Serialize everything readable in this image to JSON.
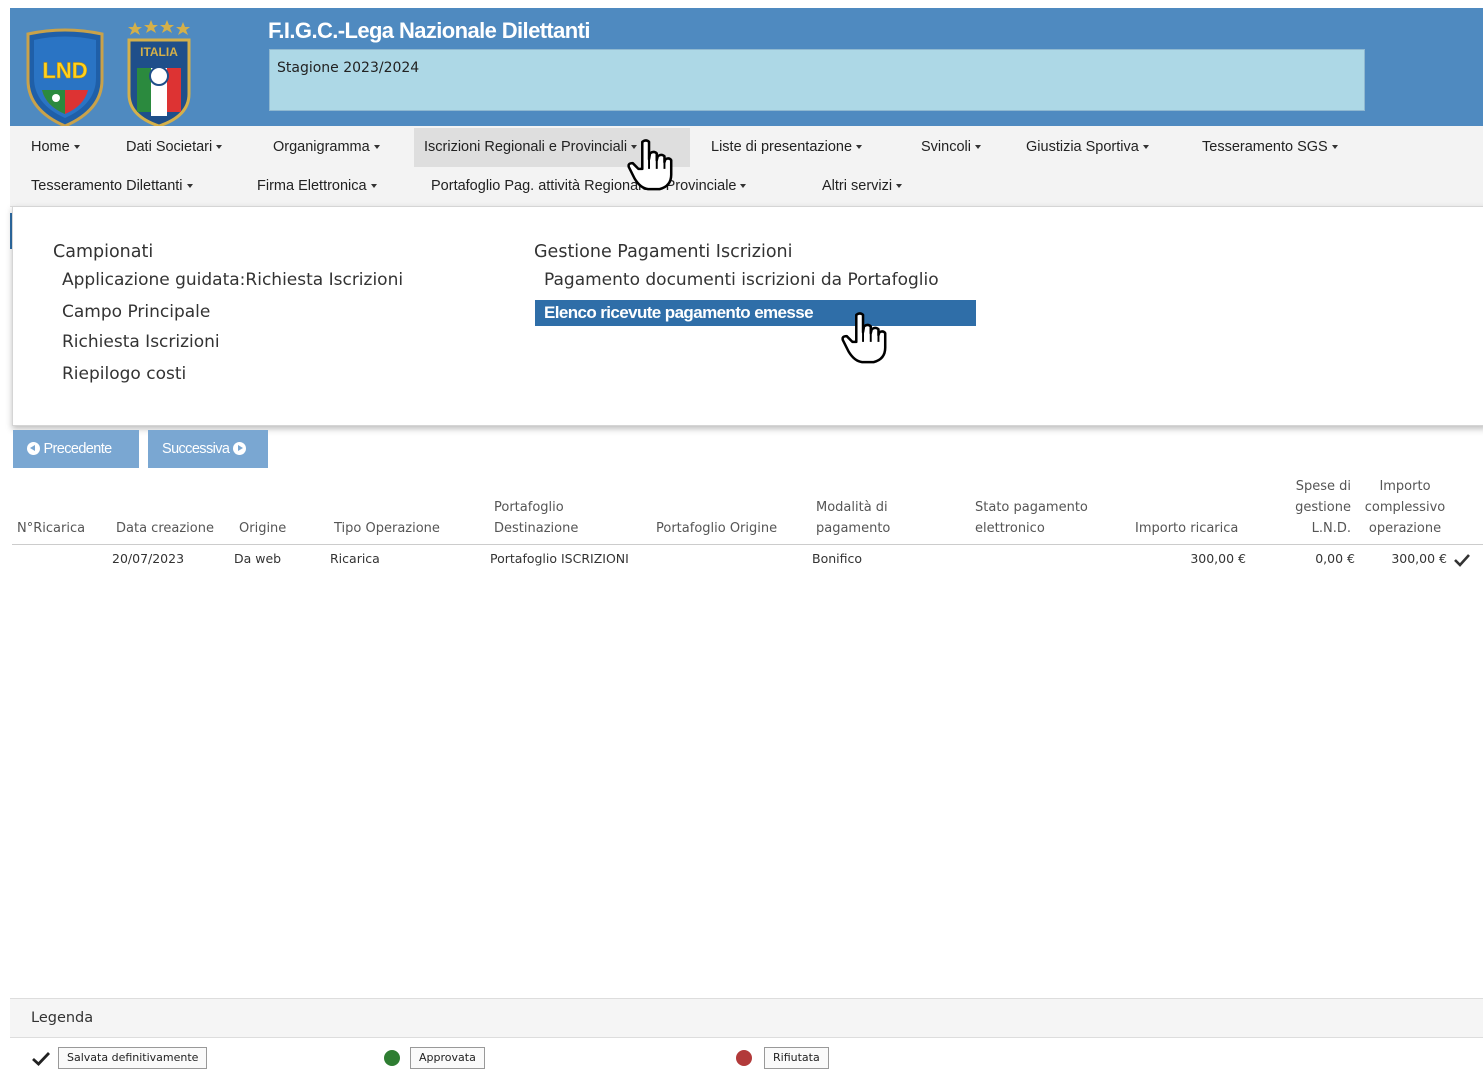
{
  "header": {
    "title": "F.I.G.C.-Lega Nazionale Dilettanti",
    "season": "Stagione 2023/2024",
    "logo_left_text": "LND",
    "logo_right_text": "ITALIA"
  },
  "nav": {
    "row1": [
      {
        "label": "Home"
      },
      {
        "label": "Dati Societari"
      },
      {
        "label": "Organigramma"
      },
      {
        "label": "Iscrizioni Regionali e Provinciali"
      },
      {
        "label": "Liste di presentazione"
      },
      {
        "label": "Svincoli"
      },
      {
        "label": "Giustizia Sportiva"
      },
      {
        "label": "Tesseramento SGS"
      }
    ],
    "row2": [
      {
        "label": "Tesseramento Dilettanti"
      },
      {
        "label": "Firma Elettronica"
      },
      {
        "label": "Portafoglio Pag. attività Regionale e Provinciale"
      },
      {
        "label": "Altri servizi"
      }
    ],
    "active": "Iscrizioni Regionali e Provinciali"
  },
  "dropdown": {
    "col1": {
      "heading": "Campionati",
      "items": [
        "Applicazione guidata:Richiesta Iscrizioni",
        "Campo Principale",
        "Richiesta Iscrizioni",
        "Riepilogo costi"
      ]
    },
    "col2": {
      "heading": "Gestione Pagamenti Iscrizioni",
      "items": [
        "Pagamento documenti iscrizioni da Portafoglio",
        "Elenco ricevute pagamento emesse"
      ],
      "selected_index": 1
    }
  },
  "pager": {
    "prev_label": "Precedente",
    "next_label": "Successiva"
  },
  "table": {
    "headers": [
      [
        "N°Ricarica"
      ],
      [
        "Data creazione"
      ],
      [
        "Origine"
      ],
      [
        "Tipo Operazione"
      ],
      [
        "Portafoglio",
        "Destinazione"
      ],
      [
        "Portafoglio Origine"
      ],
      [
        "Modalità di",
        "pagamento"
      ],
      [
        "Stato pagamento",
        "elettronico"
      ],
      [
        "Importo ricarica"
      ],
      [
        "Spese di",
        "gestione",
        "L.N.D."
      ],
      [
        "Importo",
        "complessivo",
        "operazione"
      ]
    ],
    "rows": [
      {
        "numero": "",
        "data": "20/07/2023",
        "origine": "Da web",
        "tipo": "Ricarica",
        "destinazione": "Portafoglio ISCRIZIONI",
        "portafoglio_origine": "",
        "modalita": "Bonifico",
        "stato": "",
        "importo": "300,00 €",
        "spese": "0,00 €",
        "totale": "300,00 €",
        "status_icon": "check-icon"
      }
    ]
  },
  "legend": {
    "title": "Legenda",
    "items": [
      {
        "label": "Salvata definitivamente",
        "icon": "check-icon"
      },
      {
        "label": "Approvata",
        "icon": "green-dot",
        "color": "#2e7d32"
      },
      {
        "label": "Rifiutata",
        "icon": "red-dot",
        "color": "#b23a3a"
      }
    ]
  },
  "colors": {
    "header_bg": "#4f8ac0",
    "season_box": "#add8e6",
    "selected_bg": "#2f6ea8",
    "button_bg": "#7aa7d2"
  }
}
